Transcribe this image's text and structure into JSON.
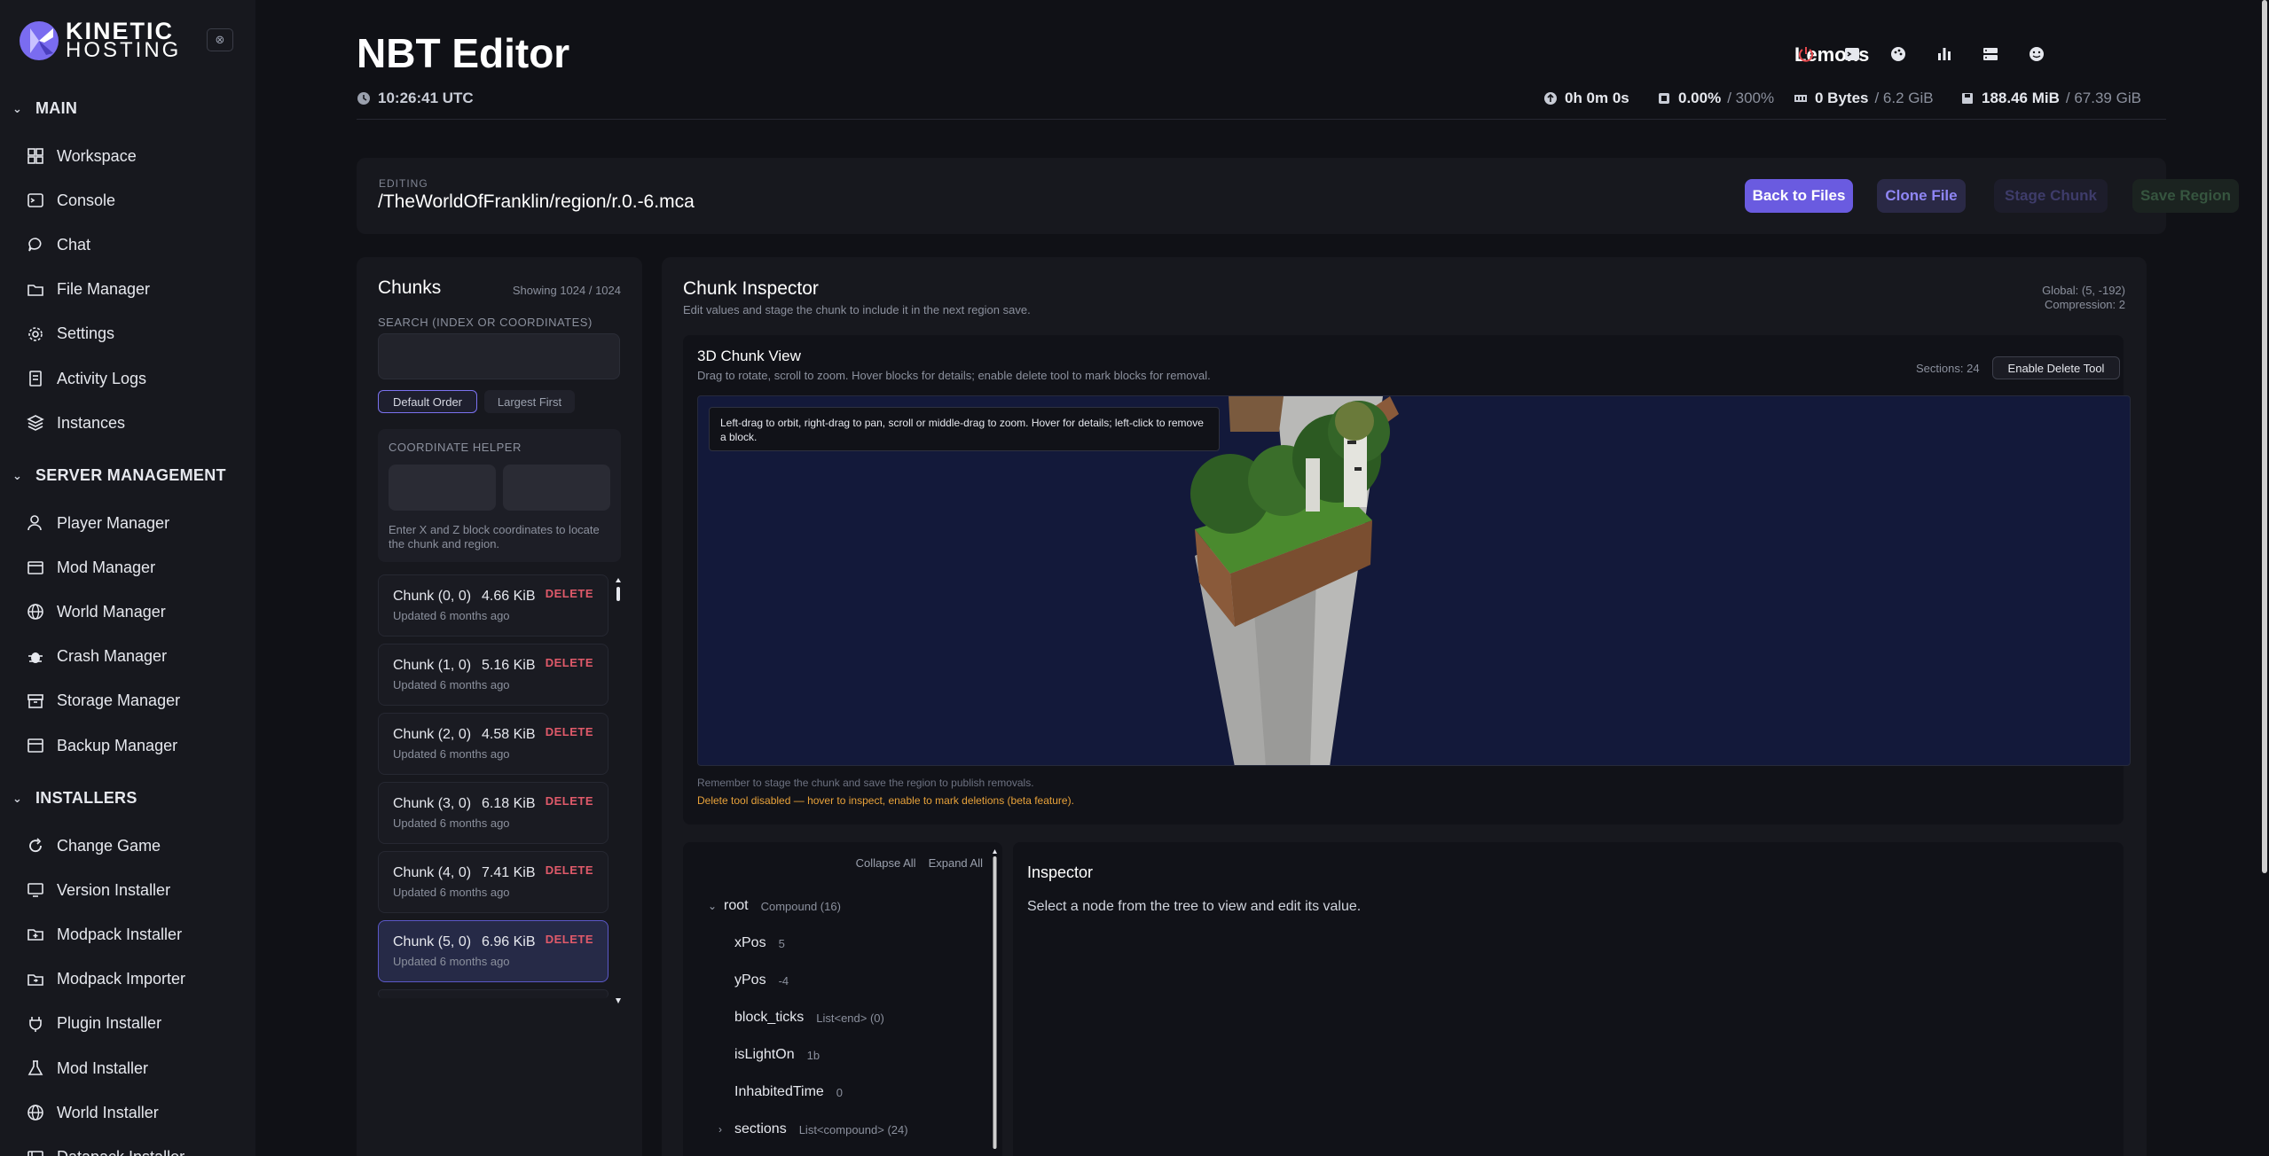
{
  "brand": {
    "line1": "KINETIC",
    "line2": "HOSTING"
  },
  "sidebar": {
    "collapse_icon": "collapse-icon",
    "sections": [
      {
        "label": "MAIN",
        "items": [
          {
            "label": "Workspace",
            "icon": "grid-icon"
          },
          {
            "label": "Console",
            "icon": "terminal-icon"
          },
          {
            "label": "Chat",
            "icon": "chat-icon"
          },
          {
            "label": "File Manager",
            "icon": "folder-icon"
          },
          {
            "label": "Settings",
            "icon": "gear-icon"
          },
          {
            "label": "Activity Logs",
            "icon": "log-icon"
          },
          {
            "label": "Instances",
            "icon": "layers-icon"
          }
        ]
      },
      {
        "label": "SERVER MANAGEMENT",
        "items": [
          {
            "label": "Player Manager",
            "icon": "user-icon"
          },
          {
            "label": "Mod Manager",
            "icon": "box-icon"
          },
          {
            "label": "World Manager",
            "icon": "globe-icon"
          },
          {
            "label": "Crash Manager",
            "icon": "bug-icon"
          },
          {
            "label": "Storage Manager",
            "icon": "archive-icon"
          },
          {
            "label": "Backup Manager",
            "icon": "backup-icon"
          }
        ]
      },
      {
        "label": "INSTALLERS",
        "items": [
          {
            "label": "Change Game",
            "icon": "refresh-icon"
          },
          {
            "label": "Version Installer",
            "icon": "monitor-icon"
          },
          {
            "label": "Modpack Installer",
            "icon": "folder-plus-icon"
          },
          {
            "label": "Modpack Importer",
            "icon": "import-icon"
          },
          {
            "label": "Plugin Installer",
            "icon": "plug-icon"
          },
          {
            "label": "Mod Installer",
            "icon": "flask-icon"
          },
          {
            "label": "World Installer",
            "icon": "globe-icon"
          },
          {
            "label": "Datapack Installer",
            "icon": "datapack-icon"
          }
        ]
      }
    ]
  },
  "header": {
    "title": "NBT Editor",
    "time": "10:26:41 UTC",
    "user": "Lemons",
    "icons": [
      "power-icon",
      "terminal-icon",
      "palette-icon",
      "chart-icon",
      "server-icon",
      "face-icon"
    ],
    "power_color": "#e5484d",
    "uptime": "0h 0m 0s",
    "cpu": "0.00%",
    "cpu_max": "/ 300%",
    "memory": "0 Bytes",
    "memory_max": "/ 6.2 GiB",
    "disk": "188.46 MiB",
    "disk_max": "/ 67.39 GiB"
  },
  "editing": {
    "label": "EDITING",
    "path": "/TheWorldOfFranklin/region/r.0.-6.mca",
    "buttons": {
      "back": "Back to Files",
      "clone": "Clone File",
      "stage": "Stage Chunk",
      "save": "Save Region"
    }
  },
  "chunks": {
    "title": "Chunks",
    "count": "Showing 1024 / 1024",
    "search_label": "SEARCH (INDEX OR COORDINATES)",
    "search_value": "",
    "order_default": "Default Order",
    "order_largest": "Largest First",
    "coord_label": "COORDINATE HELPER",
    "coord_x": "",
    "coord_z": "",
    "coord_hint": "Enter X and Z block coordinates to locate the chunk and region.",
    "delete_label": "DELETE",
    "items": [
      {
        "name": "Chunk (0, 0)",
        "size": "4.66 KiB",
        "updated": "Updated 6 months ago",
        "selected": false
      },
      {
        "name": "Chunk (1, 0)",
        "size": "5.16 KiB",
        "updated": "Updated 6 months ago",
        "selected": false
      },
      {
        "name": "Chunk (2, 0)",
        "size": "4.58 KiB",
        "updated": "Updated 6 months ago",
        "selected": false
      },
      {
        "name": "Chunk (3, 0)",
        "size": "6.18 KiB",
        "updated": "Updated 6 months ago",
        "selected": false
      },
      {
        "name": "Chunk (4, 0)",
        "size": "7.41 KiB",
        "updated": "Updated 6 months ago",
        "selected": false
      },
      {
        "name": "Chunk (5, 0)",
        "size": "6.96 KiB",
        "updated": "Updated 6 months ago",
        "selected": true
      }
    ]
  },
  "inspector": {
    "title": "Chunk Inspector",
    "subtitle": "Edit values and stage the chunk to include it in the next region save.",
    "global": "Global: (5, -192)",
    "compression": "Compression: 2",
    "view": {
      "title": "3D Chunk View",
      "subtitle": "Drag to rotate, scroll to zoom. Hover blocks for details; enable delete tool to mark blocks for removal.",
      "sections": "Sections: 24",
      "delete_tool": "Enable Delete Tool",
      "tooltip": "Left-drag to orbit, right-drag to pan, scroll or middle-drag to zoom. Hover for details; left-click to remove a block.",
      "note": "Remember to stage the chunk and save the region to publish removals.",
      "warning": "Delete tool disabled — hover to inspect, enable to mark deletions (beta feature)."
    },
    "tree": {
      "collapse_all": "Collapse All",
      "expand_all": "Expand All",
      "rows": [
        {
          "arrow": "⌄",
          "key": "root",
          "meta": "Compound (16)",
          "indent": 0
        },
        {
          "arrow": "",
          "key": "xPos",
          "meta": "5",
          "indent": 1
        },
        {
          "arrow": "",
          "key": "yPos",
          "meta": "-4",
          "indent": 1
        },
        {
          "arrow": "",
          "key": "block_ticks",
          "meta": "List<end> (0)",
          "indent": 1
        },
        {
          "arrow": "",
          "key": "isLightOn",
          "meta": "1b",
          "indent": 1
        },
        {
          "arrow": "",
          "key": "InhabitedTime",
          "meta": "0",
          "indent": 1
        },
        {
          "arrow": "›",
          "key": "sections",
          "meta": "List<compound> (24)",
          "indent": 1
        }
      ]
    },
    "panel": {
      "title": "Inspector",
      "text": "Select a node from the tree to view and edit its value."
    }
  }
}
